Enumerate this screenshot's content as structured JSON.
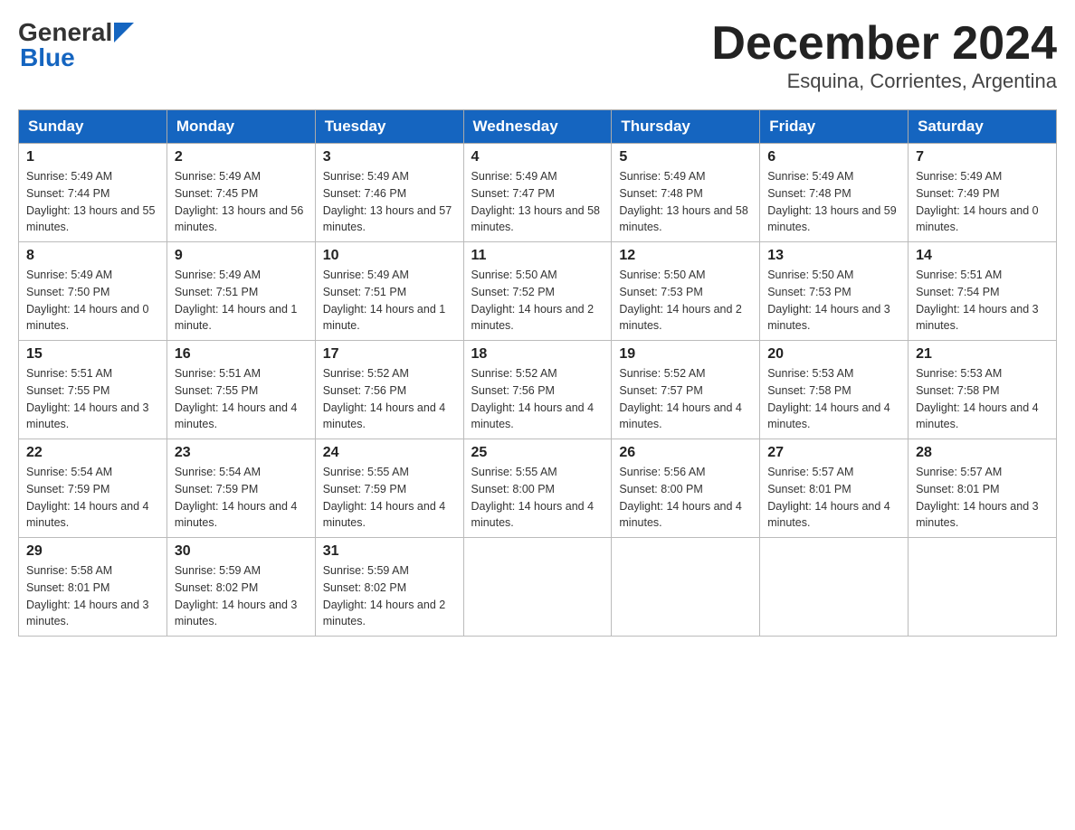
{
  "header": {
    "logo_general": "General",
    "logo_blue": "Blue",
    "title": "December 2024",
    "subtitle": "Esquina, Corrientes, Argentina"
  },
  "days_of_week": [
    "Sunday",
    "Monday",
    "Tuesday",
    "Wednesday",
    "Thursday",
    "Friday",
    "Saturday"
  ],
  "weeks": [
    [
      {
        "day": "1",
        "sunrise": "5:49 AM",
        "sunset": "7:44 PM",
        "daylight": "13 hours and 55 minutes."
      },
      {
        "day": "2",
        "sunrise": "5:49 AM",
        "sunset": "7:45 PM",
        "daylight": "13 hours and 56 minutes."
      },
      {
        "day": "3",
        "sunrise": "5:49 AM",
        "sunset": "7:46 PM",
        "daylight": "13 hours and 57 minutes."
      },
      {
        "day": "4",
        "sunrise": "5:49 AM",
        "sunset": "7:47 PM",
        "daylight": "13 hours and 58 minutes."
      },
      {
        "day": "5",
        "sunrise": "5:49 AM",
        "sunset": "7:48 PM",
        "daylight": "13 hours and 58 minutes."
      },
      {
        "day": "6",
        "sunrise": "5:49 AM",
        "sunset": "7:48 PM",
        "daylight": "13 hours and 59 minutes."
      },
      {
        "day": "7",
        "sunrise": "5:49 AM",
        "sunset": "7:49 PM",
        "daylight": "14 hours and 0 minutes."
      }
    ],
    [
      {
        "day": "8",
        "sunrise": "5:49 AM",
        "sunset": "7:50 PM",
        "daylight": "14 hours and 0 minutes."
      },
      {
        "day": "9",
        "sunrise": "5:49 AM",
        "sunset": "7:51 PM",
        "daylight": "14 hours and 1 minute."
      },
      {
        "day": "10",
        "sunrise": "5:49 AM",
        "sunset": "7:51 PM",
        "daylight": "14 hours and 1 minute."
      },
      {
        "day": "11",
        "sunrise": "5:50 AM",
        "sunset": "7:52 PM",
        "daylight": "14 hours and 2 minutes."
      },
      {
        "day": "12",
        "sunrise": "5:50 AM",
        "sunset": "7:53 PM",
        "daylight": "14 hours and 2 minutes."
      },
      {
        "day": "13",
        "sunrise": "5:50 AM",
        "sunset": "7:53 PM",
        "daylight": "14 hours and 3 minutes."
      },
      {
        "day": "14",
        "sunrise": "5:51 AM",
        "sunset": "7:54 PM",
        "daylight": "14 hours and 3 minutes."
      }
    ],
    [
      {
        "day": "15",
        "sunrise": "5:51 AM",
        "sunset": "7:55 PM",
        "daylight": "14 hours and 3 minutes."
      },
      {
        "day": "16",
        "sunrise": "5:51 AM",
        "sunset": "7:55 PM",
        "daylight": "14 hours and 4 minutes."
      },
      {
        "day": "17",
        "sunrise": "5:52 AM",
        "sunset": "7:56 PM",
        "daylight": "14 hours and 4 minutes."
      },
      {
        "day": "18",
        "sunrise": "5:52 AM",
        "sunset": "7:56 PM",
        "daylight": "14 hours and 4 minutes."
      },
      {
        "day": "19",
        "sunrise": "5:52 AM",
        "sunset": "7:57 PM",
        "daylight": "14 hours and 4 minutes."
      },
      {
        "day": "20",
        "sunrise": "5:53 AM",
        "sunset": "7:58 PM",
        "daylight": "14 hours and 4 minutes."
      },
      {
        "day": "21",
        "sunrise": "5:53 AM",
        "sunset": "7:58 PM",
        "daylight": "14 hours and 4 minutes."
      }
    ],
    [
      {
        "day": "22",
        "sunrise": "5:54 AM",
        "sunset": "7:59 PM",
        "daylight": "14 hours and 4 minutes."
      },
      {
        "day": "23",
        "sunrise": "5:54 AM",
        "sunset": "7:59 PM",
        "daylight": "14 hours and 4 minutes."
      },
      {
        "day": "24",
        "sunrise": "5:55 AM",
        "sunset": "7:59 PM",
        "daylight": "14 hours and 4 minutes."
      },
      {
        "day": "25",
        "sunrise": "5:55 AM",
        "sunset": "8:00 PM",
        "daylight": "14 hours and 4 minutes."
      },
      {
        "day": "26",
        "sunrise": "5:56 AM",
        "sunset": "8:00 PM",
        "daylight": "14 hours and 4 minutes."
      },
      {
        "day": "27",
        "sunrise": "5:57 AM",
        "sunset": "8:01 PM",
        "daylight": "14 hours and 4 minutes."
      },
      {
        "day": "28",
        "sunrise": "5:57 AM",
        "sunset": "8:01 PM",
        "daylight": "14 hours and 3 minutes."
      }
    ],
    [
      {
        "day": "29",
        "sunrise": "5:58 AM",
        "sunset": "8:01 PM",
        "daylight": "14 hours and 3 minutes."
      },
      {
        "day": "30",
        "sunrise": "5:59 AM",
        "sunset": "8:02 PM",
        "daylight": "14 hours and 3 minutes."
      },
      {
        "day": "31",
        "sunrise": "5:59 AM",
        "sunset": "8:02 PM",
        "daylight": "14 hours and 2 minutes."
      },
      null,
      null,
      null,
      null
    ]
  ]
}
